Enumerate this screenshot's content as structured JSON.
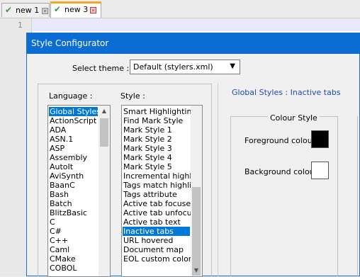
{
  "tabs": [
    {
      "label": "new 1",
      "active": false
    },
    {
      "label": "new 3",
      "active": true
    }
  ],
  "editor": {
    "line_number": "1"
  },
  "dialog": {
    "title": "Style Configurator",
    "theme_label": "Select theme :",
    "theme_value": "Default (stylers.xml)",
    "language_label": "Language :",
    "style_label": "Style :",
    "languages": [
      "Global Styles",
      "ActionScript",
      "ADA",
      "ASN.1",
      "ASP",
      "Assembly",
      "AutoIt",
      "AviSynth",
      "BaanC",
      "Bash",
      "Batch",
      "BlitzBasic",
      "C",
      "C#",
      "C++",
      "Caml",
      "CMake",
      "COBOL"
    ],
    "selected_language": "Global Styles",
    "styles": [
      "Smart Highlighting",
      "Find Mark Style",
      "Mark Style 1",
      "Mark Style 2",
      "Mark Style 3",
      "Mark Style 4",
      "Mark Style 5",
      "Incremental highlight",
      "Tags match highlight",
      "Tags attribute",
      "Active tab focused",
      "Active tab unfocused",
      "Active tab text",
      "Inactive tabs",
      "URL hovered",
      "Document map",
      "EOL custom color"
    ],
    "selected_style": "Inactive tabs",
    "description": "Global Styles : Inactive tabs",
    "colour_style_title": "Colour Style",
    "foreground_label": "Foreground colour",
    "background_label": "Background colour",
    "foreground_color": "#000000",
    "background_color": "#ffffff"
  },
  "colors": {
    "title_bar": "#0b6cd4",
    "selection": "#0078d7",
    "tab_accent": "#f5a623"
  }
}
